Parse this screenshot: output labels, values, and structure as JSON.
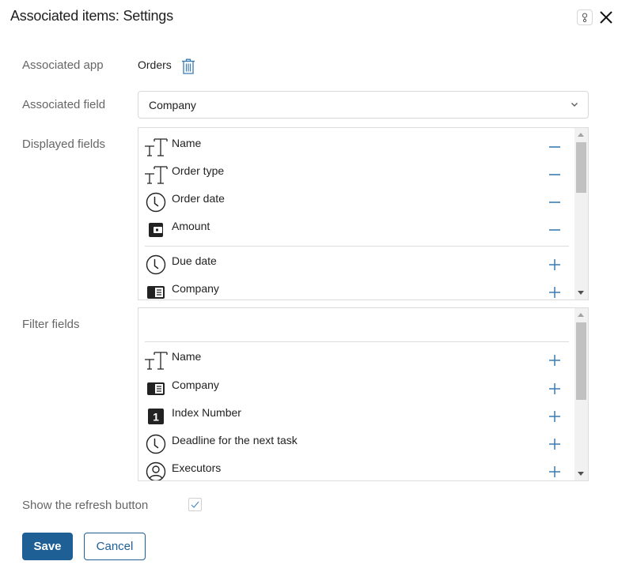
{
  "dialog": {
    "title": "Associated items: Settings",
    "help_icon": "help-icon",
    "close_icon": "close-icon"
  },
  "colors": {
    "accent": "#1e6096",
    "action_icon": "#3a7bb3",
    "label": "#666666",
    "text": "#222222"
  },
  "associated_app": {
    "label": "Associated app",
    "value": "Orders",
    "delete_icon": "trash-icon"
  },
  "associated_field": {
    "label": "Associated field",
    "value": "Company",
    "icon": "chevron-down-icon"
  },
  "displayed_fields": {
    "label": "Displayed fields",
    "selected": [
      {
        "label": "Name",
        "icon": "text-type-icon",
        "action": "remove"
      },
      {
        "label": "Order type",
        "icon": "text-type-icon",
        "action": "remove"
      },
      {
        "label": "Order date",
        "icon": "clock-icon",
        "action": "remove"
      },
      {
        "label": "Amount",
        "icon": "wallet-icon",
        "action": "remove"
      }
    ],
    "available": [
      {
        "label": "Due date",
        "icon": "clock-icon",
        "action": "add"
      },
      {
        "label": "Company",
        "icon": "app-card-icon",
        "action": "add"
      }
    ]
  },
  "filter_fields": {
    "label": "Filter fields",
    "selected": [],
    "available": [
      {
        "label": "Name",
        "icon": "text-type-icon",
        "action": "add"
      },
      {
        "label": "Company",
        "icon": "app-card-icon",
        "action": "add"
      },
      {
        "label": "Index Number",
        "icon": "number-one-icon",
        "action": "add"
      },
      {
        "label": "Deadline for the next task",
        "icon": "clock-icon",
        "action": "add"
      },
      {
        "label": "Executors",
        "icon": "user-circle-icon",
        "action": "add"
      }
    ]
  },
  "refresh": {
    "label": "Show the refresh button",
    "checked": true
  },
  "buttons": {
    "save": "Save",
    "cancel": "Cancel"
  }
}
